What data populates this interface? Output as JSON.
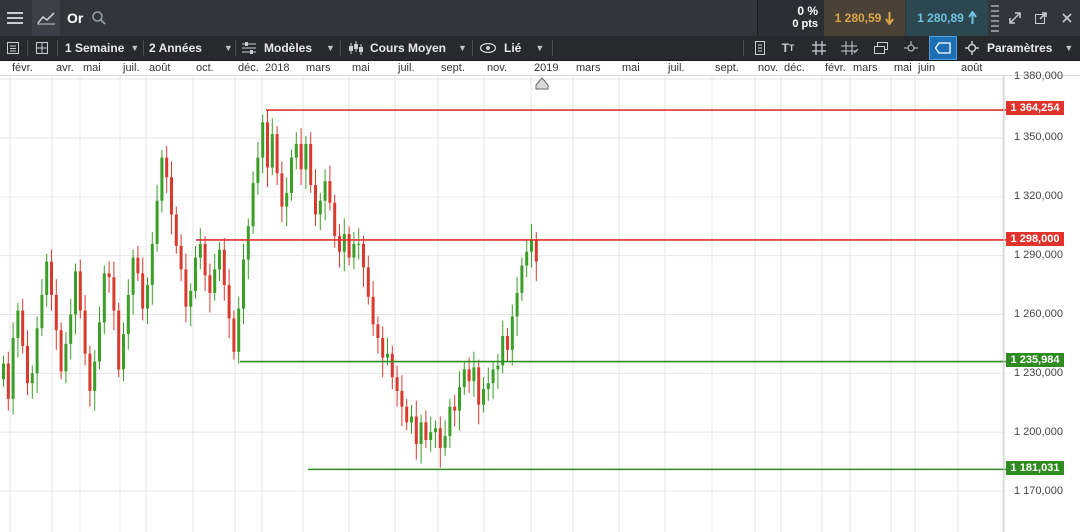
{
  "header": {
    "instrument": "Or",
    "change_percent": "0 %",
    "change_points": "0 pts",
    "sell_price": "1 280,59",
    "buy_price": "1 280,89"
  },
  "toolbar": {
    "interval": "1 Semaine",
    "range": "2 Années",
    "models": "Modèles",
    "price_type": "Cours Moyen",
    "link": "Lié",
    "settings": "Paramètres"
  },
  "date_axis": {
    "months": [
      "févr.",
      "avr.",
      "mai",
      "juil.",
      "août",
      "oct.",
      "déc.",
      "2018",
      "mars",
      "mai",
      "juil.",
      "sept.",
      "nov.",
      "2019",
      "mars",
      "mai",
      "juil.",
      "sept.",
      "nov.",
      "déc.",
      "févr.",
      "mars",
      "mai",
      "juin",
      "août"
    ]
  },
  "price_axis": {
    "ticks": [
      "1 380,000",
      "1 350,000",
      "1 320,000",
      "1 290,000",
      "1 260,000",
      "1 230,000",
      "1 200,000",
      "1 170,000"
    ]
  },
  "levels": [
    {
      "value": "1 364,254",
      "color": "#e0332b"
    },
    {
      "value": "1 298,000",
      "color": "#e0332b"
    },
    {
      "value": "1 235,984",
      "color": "#2e8b1f"
    },
    {
      "value": "1 181,031",
      "color": "#2e8b1f"
    }
  ],
  "colors": {
    "up": "#3a9e27",
    "down": "#d83a2e",
    "sell_bg": "#4a4236",
    "buy_bg": "#2d4750"
  },
  "chart_data": {
    "type": "candlestick",
    "y_range": [
      1160,
      1385
    ],
    "horizontal_levels": [
      1364.254,
      1298.0,
      1235.984,
      1181.031
    ],
    "weekly_closes": [
      1235,
      1217,
      1248,
      1262,
      1244,
      1225,
      1230,
      1253,
      1270,
      1287,
      1270,
      1252,
      1231,
      1245,
      1260,
      1282,
      1262,
      1240,
      1221,
      1236,
      1256,
      1281,
      1279,
      1262,
      1232,
      1250,
      1270,
      1289,
      1281,
      1263,
      1275,
      1296,
      1318,
      1340,
      1330,
      1311,
      1295,
      1283,
      1264,
      1272,
      1289,
      1296,
      1280,
      1271,
      1283,
      1293,
      1275,
      1258,
      1241,
      1263,
      1288,
      1305,
      1327,
      1340,
      1358,
      1335,
      1352,
      1332,
      1315,
      1322,
      1340,
      1347,
      1334,
      1347,
      1326,
      1311,
      1318,
      1328,
      1317,
      1300,
      1292,
      1301,
      1289,
      1296,
      1296,
      1284,
      1269,
      1255,
      1248,
      1238,
      1240,
      1228,
      1221,
      1213,
      1205,
      1208,
      1194,
      1205,
      1196,
      1200,
      1202,
      1192,
      1198,
      1213,
      1211,
      1223,
      1232,
      1226,
      1233,
      1214,
      1222,
      1225,
      1232,
      1234,
      1249,
      1242,
      1259,
      1271,
      1285,
      1292,
      1298,
      1287
    ]
  }
}
